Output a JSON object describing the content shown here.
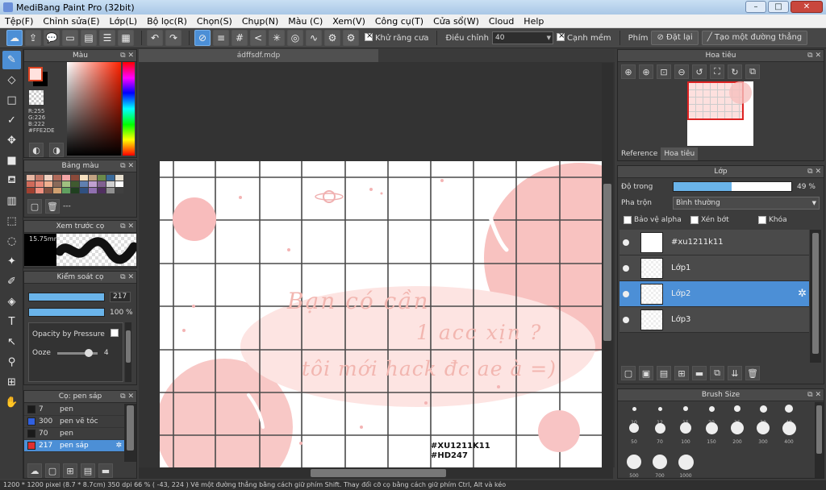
{
  "window": {
    "title": "MediBang Paint Pro (32bit)",
    "minimize": "–",
    "maximize": "□",
    "close": "✕"
  },
  "menu": [
    "Tệp(F)",
    "Chỉnh sửa(E)",
    "Lớp(L)",
    "Bộ lọc(R)",
    "Chọn(S)",
    "Chụp(N)",
    "Màu (C)",
    "Xem(V)",
    "Công cụ(T)",
    "Cửa sổ(W)",
    "Cloud",
    "Help"
  ],
  "toolbar": {
    "antialias_label": "Khử răng cưa",
    "adjust_label": "Điều chỉnh",
    "adjust_value": "40",
    "soften_label": "Cạnh mềm",
    "key_label": "Phím",
    "reset_label": "Đặt lại",
    "straight_line_label": "Tạo một đường thẳng"
  },
  "color_panel": {
    "title": "Màu",
    "r": "R:255",
    "g": "G:226",
    "b": "B:222",
    "hex": "#FFE2DE",
    "fg_color": "#ffe2de"
  },
  "palette_panel": {
    "title": "Bảng màu",
    "colors": [
      "#e7b6a2",
      "#c47a6a",
      "#f0d2c2",
      "#b06a5a",
      "#f4a6a6",
      "#8a4a3a",
      "#f7e0c0",
      "#c2a282",
      "#6a8a4a",
      "#3a6a9a",
      "#e8e0d0",
      "#d06a5a",
      "#e88a7a",
      "#f0b090",
      "#8a6a5a",
      "#a0c080",
      "#405a30",
      "#6080b0",
      "#c0a0d0",
      "#806090",
      "#d0d0d0",
      "#ffffff",
      "#a04030",
      "#f09080",
      "#805040",
      "#d0a070",
      "#60a060",
      "#204020",
      "#305080",
      "#9070b0",
      "#503060",
      "#909090",
      "#404040"
    ],
    "dash": "---"
  },
  "brush_preview": {
    "title": "Xem trước cọ",
    "size": "15.75mm"
  },
  "brush_control": {
    "title": "Kiểm soát cọ",
    "size_value": "217",
    "opacity_value": "100 %",
    "opacity_pressure_label": "Opacity by Pressure",
    "ooze_label": "Ooze",
    "ooze_value": "4"
  },
  "brush_list": {
    "title": "Cọ: pen sáp",
    "items": [
      {
        "num": "7",
        "name": "pen",
        "color": "#1a1a1a"
      },
      {
        "num": "300",
        "name": "pen vẽ tóc",
        "color": "#3060e0"
      },
      {
        "num": "70",
        "name": "pen",
        "color": "#1a1a1a"
      },
      {
        "num": "217",
        "name": "pen sáp",
        "color": "#e03030"
      }
    ]
  },
  "document": {
    "tab": "ádffsdf.mdp",
    "text_line1": "Bạn  có  cần",
    "text_line2": "1 acc  xịn ?",
    "text_line3": "tôi  mới  hack  đc  ae  à =)",
    "tag_line1": "#XU1211K11",
    "tag_line2": "#HD247"
  },
  "navigator": {
    "title": "Hoa tiêu",
    "tab_reference": "Reference",
    "tab_navigator": "Hoa tiêu"
  },
  "layers": {
    "title": "Lớp",
    "opacity_label": "Độ trong",
    "opacity_value": "49 %",
    "blend_label": "Pha trộn",
    "blend_value": "Bình thường",
    "protect_alpha": "Bảo vệ alpha",
    "clip": "Xén bớt",
    "lock": "Khóa",
    "items": [
      "#xu1211k11",
      "Lớp1",
      "Lớp2",
      "Lớp3"
    ]
  },
  "brush_size_panel": {
    "title": "Brush Size",
    "row1_labels": [
      "10",
      "12",
      "15",
      "20",
      "25",
      "30",
      "40"
    ],
    "row2_labels": [
      "50",
      "70",
      "100",
      "150",
      "200",
      "300",
      "400"
    ],
    "row3_labels": [
      "500",
      "700",
      "1000"
    ]
  },
  "status": {
    "text": "1200 * 1200 pixel  (8.7 * 8.7cm)  350 dpi  66 %  ( -43, 224 )  Vẽ một đường thẳng bằng cách giữ phím Shift. Thay đổi cỡ cọ bằng cách giữ phím Ctrl, Alt và kéo"
  }
}
